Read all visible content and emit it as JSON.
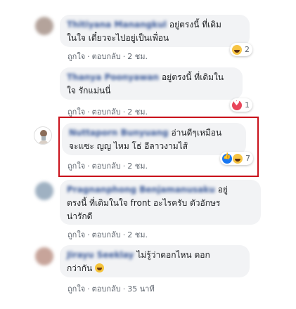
{
  "comments": [
    {
      "author": "Thitiyana Manangkul",
      "text": "อยู่ตรงนี้ ที่เดิม ในใจ เดี๋ยวจะไปอยู่เป็นเพื่อน",
      "line1": "อยู่ตรงนี้ ที่เดิม",
      "line2": "ในใจ เดี๋ยวจะไปอยู่เป็นเพื่อน",
      "like": "ถูกใจ",
      "reply": "ตอบกลับ",
      "time": "2 ชม.",
      "reaction_count": "2",
      "reaction_icons": [
        "haha-icon"
      ]
    },
    {
      "author": "Thanya Poonyawan",
      "line1": "อยู่ตรงนี้ ที่เดิมใน",
      "line2": "ใจ รักแม่นนี่",
      "like": "ถูกใจ",
      "reply": "ตอบกลับ",
      "time": "2 ชม.",
      "reaction_count": "1",
      "reaction_icons": [
        "love-icon"
      ]
    },
    {
      "author": "Nuttaporn Bunyuang",
      "line1": "อ่านดีๆเหมือน",
      "line2": "จะแซะ ญญ ไหม โธ่ อีลาวงามไส้",
      "like": "ถูกใจ",
      "reply": "ตอบกลับ",
      "time": "2 ชม.",
      "reaction_count": "7",
      "reaction_icons": [
        "like-icon",
        "haha-icon"
      ]
    },
    {
      "author": "Pragnanphong Benjamanusaku",
      "line1": "อยู่",
      "line2": "ตรงนี้ ที่เดิมในใจ front อะไรครับ ตัวอักษร",
      "line3": "น่ารักดี",
      "like": "ถูกใจ",
      "reply": "ตอบกลับ",
      "time": "2 ชม."
    },
    {
      "author": "Jirayu Seeklay",
      "line1": "ไม่รู้ว่าดอกไหน ดอก",
      "line2": "กว่ากัน",
      "like": "ถูกใจ",
      "reply": "ตอบกลับ",
      "time": "35 นาที"
    }
  ],
  "separator": "·",
  "colors": {
    "author_link": "#385898",
    "bubble_bg": "#f2f3f5",
    "highlight_border": "#c9111a",
    "meta_text": "#606770"
  }
}
